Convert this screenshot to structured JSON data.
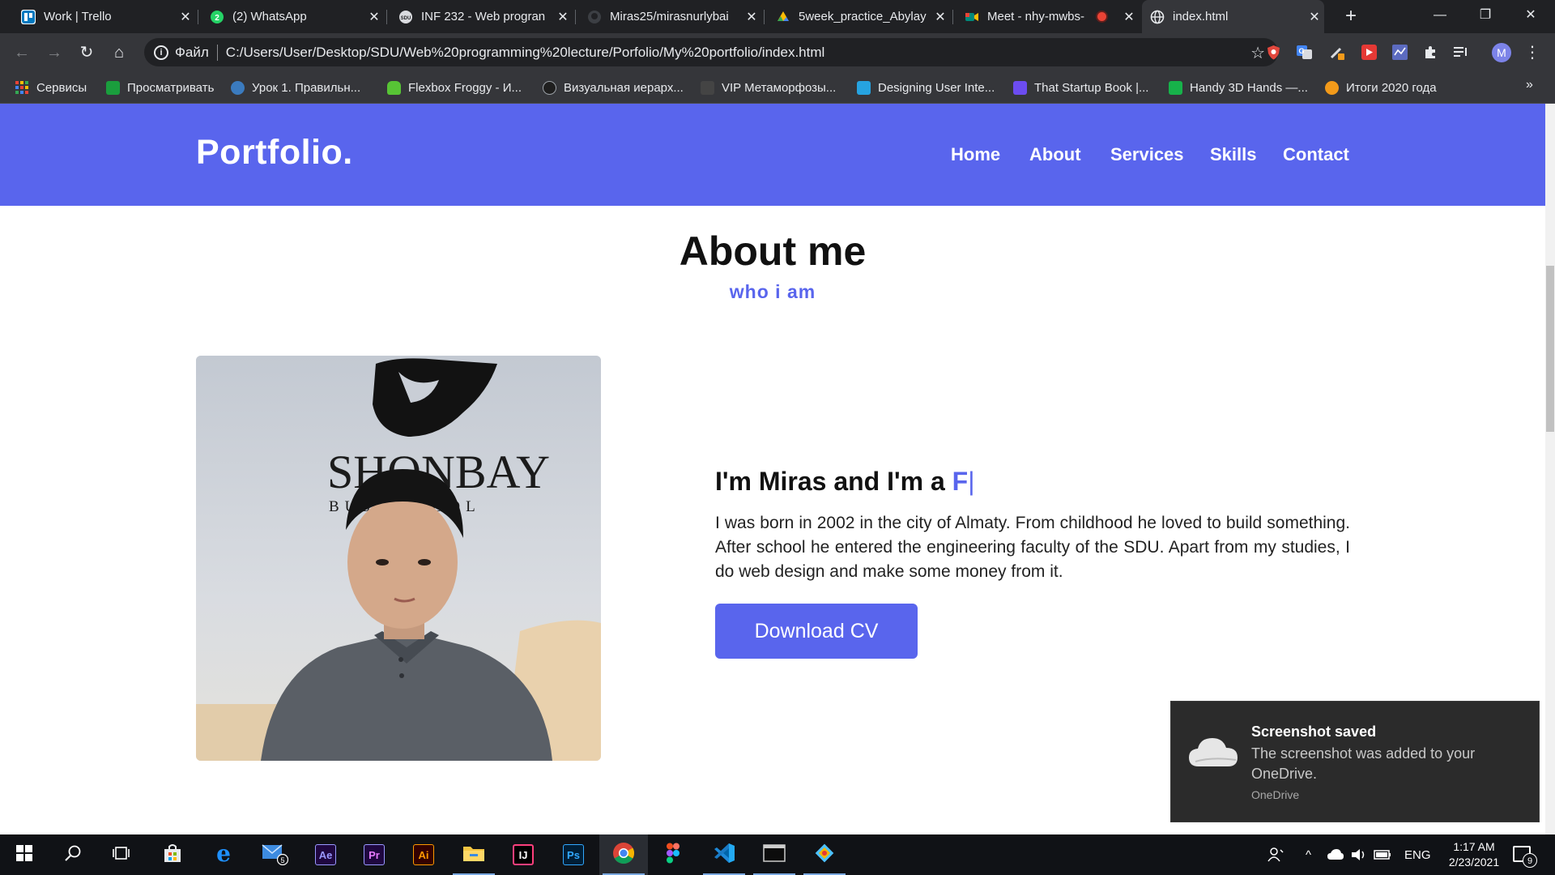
{
  "browser": {
    "tabs": [
      {
        "title": "Work | Trello",
        "icon": "trello-icon",
        "color": "#0079bf"
      },
      {
        "title": "(2) WhatsApp",
        "icon": "whatsapp-icon",
        "color": "#25d366"
      },
      {
        "title": "INF 232 - Web progran",
        "icon": "sdu-icon",
        "color": "#9aa0a6"
      },
      {
        "title": "Miras25/mirasnurlybai",
        "icon": "github-icon",
        "color": "#24292e"
      },
      {
        "title": "5week_practice_Abylay",
        "icon": "google-drive-icon",
        "color": "#fbbc04"
      },
      {
        "title": "Meet - nhy-mwbs-",
        "icon": "google-meet-icon",
        "color": "#00897b"
      },
      {
        "title": "index.html",
        "icon": "globe-icon",
        "color": "#9aa0a6"
      }
    ],
    "omnibox": {
      "scheme_label": "Файл",
      "url": "C:/Users/User/Desktop/SDU/Web%20programming%20lecture/Porfolio/My%20portfolio/index.html"
    },
    "profile_initial": "M",
    "bookmarks": [
      {
        "label": "Сервисы",
        "icon": "apps-grid-icon",
        "color": "#e94235"
      },
      {
        "label": "Просматривать",
        "icon": "bookmark-icon",
        "color": "#1a9e3d"
      },
      {
        "label": "Урок 1. Правильн...",
        "icon": "globe-icon",
        "color": "#3b7bbf"
      },
      {
        "label": "Flexbox Froggy - И...",
        "icon": "frog-icon",
        "color": "#57c435"
      },
      {
        "label": "Визуальная иерарх...",
        "icon": "medium-icon",
        "color": "#1f1f1f"
      },
      {
        "label": "VIP Метаморфозы...",
        "icon": "vip-icon",
        "color": "#444444"
      },
      {
        "label": "Designing User Inte...",
        "icon": "ui-icon",
        "color": "#26a3e0"
      },
      {
        "label": "That Startup Book |...",
        "icon": "s-icon",
        "color": "#6c4cf0"
      },
      {
        "label": "Handy 3D Hands —...",
        "icon": "hands-icon",
        "color": "#17b24a"
      },
      {
        "label": "Итоги 2020 года",
        "icon": "swirl-icon",
        "color": "#f29a1a"
      }
    ]
  },
  "site": {
    "logo": "Portfolio.",
    "nav": [
      "Home",
      "About",
      "Services",
      "Skills",
      "Contact"
    ],
    "accent_color": "#5965ed",
    "about": {
      "title": "About me",
      "subtitle": "who i am",
      "photo": {
        "sign_line1": "SHONBAY",
        "sign_line2": "BUS         SCHOOL"
      },
      "intro_prefix": "I'm Miras and I'm a ",
      "intro_typed": "F",
      "cursor": "|",
      "bio": "I was born in 2002 in the city of Almaty. From childhood he loved to build something. After school he entered the engineering faculty of the SDU. Apart from my studies, I do web design and make some money from it.",
      "cta": "Download CV"
    }
  },
  "toast": {
    "title": "Screenshot saved",
    "body": "The screenshot was added to your OneDrive.",
    "source": "OneDrive"
  },
  "taskbar": {
    "apps": [
      {
        "name": "mail-app",
        "label": "",
        "color": "#3d8be0",
        "badge": "5"
      },
      {
        "name": "after-effects-app",
        "label": "Ae",
        "color": "#9999ff"
      },
      {
        "name": "premiere-app",
        "label": "Pr",
        "color": "#9999ff"
      },
      {
        "name": "illustrator-app",
        "label": "Ai",
        "color": "#ff9a00"
      },
      {
        "name": "explorer-app",
        "label": "",
        "color": "#f4c542"
      },
      {
        "name": "intellij-app",
        "label": "IJ",
        "color": "#ffffff"
      },
      {
        "name": "photoshop-app",
        "label": "Ps",
        "color": "#31a8ff"
      },
      {
        "name": "chrome-app",
        "label": "",
        "color": "#4285f4"
      },
      {
        "name": "figma-app",
        "label": "",
        "color": "#f24e1e"
      },
      {
        "name": "vscode-app",
        "label": "",
        "color": "#23a9f2"
      },
      {
        "name": "terminal-app",
        "label": "",
        "color": "#cccccc"
      },
      {
        "name": "git-app",
        "label": "",
        "color": "#4cc2ff"
      }
    ],
    "lang": "ENG",
    "time": "1:17 AM",
    "date": "2/23/2021",
    "notification_count": "9"
  }
}
